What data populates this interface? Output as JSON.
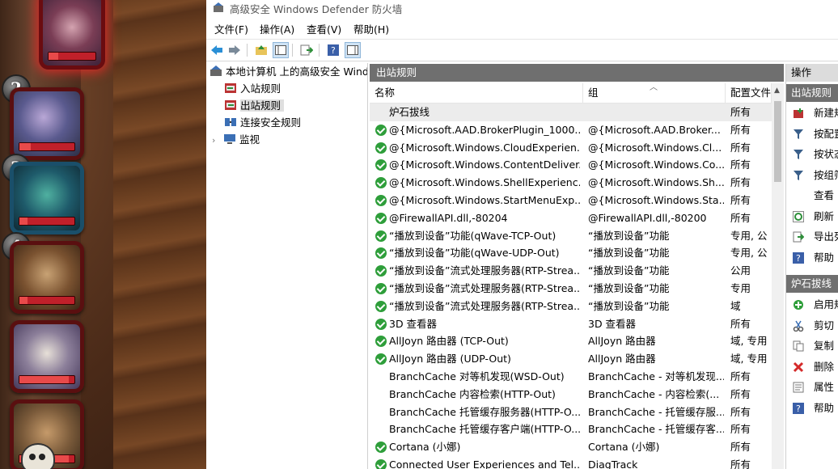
{
  "window": {
    "title": "高级安全 Windows Defender 防火墙"
  },
  "menu": [
    {
      "label": "文件(F)"
    },
    {
      "label": "操作(A)"
    },
    {
      "label": "查看(V)"
    },
    {
      "label": "帮助(H)"
    }
  ],
  "toolbar": [
    {
      "icon": "back-arrow-icon"
    },
    {
      "icon": "forward-arrow-icon"
    },
    {
      "icon": "up-folder-icon"
    },
    {
      "icon": "show-hide-tree-icon"
    },
    {
      "icon": "export-list-icon"
    },
    {
      "icon": "help-icon"
    },
    {
      "icon": "show-hide-action-pane-icon"
    }
  ],
  "tree": {
    "root": "本地计算机 上的高级安全 Windows Defender 防火墙",
    "items": [
      {
        "label": "入站规则"
      },
      {
        "label": "出站规则",
        "selected": true
      },
      {
        "label": "连接安全规则"
      },
      {
        "label": "监视",
        "expandable": true
      }
    ]
  },
  "list": {
    "header": "出站规则",
    "columns": [
      "名称",
      "组",
      "配置文件"
    ],
    "rows": [
      {
        "type": "group",
        "name": "炉石拔线",
        "group": "",
        "profile": "所有"
      },
      {
        "enabled": true,
        "name": "@{Microsoft.AAD.BrokerPlugin_1000....",
        "group": "@{Microsoft.AAD.Broker...",
        "profile": "所有"
      },
      {
        "enabled": true,
        "name": "@{Microsoft.Windows.CloudExperien...",
        "group": "@{Microsoft.Windows.Cl...",
        "profile": "所有"
      },
      {
        "enabled": true,
        "name": "@{Microsoft.Windows.ContentDeliver...",
        "group": "@{Microsoft.Windows.Co...",
        "profile": "所有"
      },
      {
        "enabled": true,
        "name": "@{Microsoft.Windows.ShellExperienc...",
        "group": "@{Microsoft.Windows.Sh...",
        "profile": "所有"
      },
      {
        "enabled": true,
        "name": "@{Microsoft.Windows.StartMenuExp...",
        "group": "@{Microsoft.Windows.Sta...",
        "profile": "所有"
      },
      {
        "enabled": true,
        "name": "@FirewallAPI.dll,-80204",
        "group": "@FirewallAPI.dll,-80200",
        "profile": "所有"
      },
      {
        "enabled": true,
        "name": "“播放到设备”功能(qWave-TCP-Out)",
        "group": "“播放到设备”功能",
        "profile": "专用, 公"
      },
      {
        "enabled": true,
        "name": "“播放到设备”功能(qWave-UDP-Out)",
        "group": "“播放到设备”功能",
        "profile": "专用, 公"
      },
      {
        "enabled": true,
        "name": "“播放到设备”流式处理服务器(RTP-Strea...",
        "group": "“播放到设备”功能",
        "profile": "公用"
      },
      {
        "enabled": true,
        "name": "“播放到设备”流式处理服务器(RTP-Strea...",
        "group": "“播放到设备”功能",
        "profile": "专用"
      },
      {
        "enabled": true,
        "name": "“播放到设备”流式处理服务器(RTP-Strea...",
        "group": "“播放到设备”功能",
        "profile": "域"
      },
      {
        "enabled": true,
        "name": "3D 查看器",
        "group": "3D 查看器",
        "profile": "所有"
      },
      {
        "enabled": true,
        "name": "AllJoyn 路由器 (TCP-Out)",
        "group": "AllJoyn 路由器",
        "profile": "域, 专用"
      },
      {
        "enabled": true,
        "name": "AllJoyn 路由器 (UDP-Out)",
        "group": "AllJoyn 路由器",
        "profile": "域, 专用"
      },
      {
        "enabled": false,
        "name": "BranchCache 对等机发现(WSD-Out)",
        "group": "BranchCache - 对等机发现...",
        "profile": "所有"
      },
      {
        "enabled": false,
        "name": "BranchCache 内容检索(HTTP-Out)",
        "group": "BranchCache - 内容检索(...",
        "profile": "所有"
      },
      {
        "enabled": false,
        "name": "BranchCache 托管缓存服务器(HTTP-O...",
        "group": "BranchCache - 托管缓存服...",
        "profile": "所有"
      },
      {
        "enabled": false,
        "name": "BranchCache 托管缓存客户端(HTTP-O...",
        "group": "BranchCache - 托管缓存客...",
        "profile": "所有"
      },
      {
        "enabled": true,
        "name": "Cortana (小娜)",
        "group": "Cortana (小娜)",
        "profile": "所有"
      },
      {
        "enabled": true,
        "name": "Connected User Experiences and Tel...",
        "group": "DiagTrack",
        "profile": "所有"
      }
    ]
  },
  "actions": {
    "header": "操作",
    "section1": {
      "title": "出站规则",
      "items": [
        {
          "label": "新建规则...",
          "icon": "new-rule-icon"
        },
        {
          "label": "按配置文件筛选",
          "icon": "filter-icon"
        },
        {
          "label": "按状态筛选",
          "icon": "filter-icon"
        },
        {
          "label": "按组筛选",
          "icon": "filter-icon"
        },
        {
          "label": "查看",
          "icon": ""
        },
        {
          "label": "刷新",
          "icon": "refresh-icon"
        },
        {
          "label": "导出列表...",
          "icon": "export-icon"
        },
        {
          "label": "帮助",
          "icon": "help-icon"
        }
      ]
    },
    "section2": {
      "title": "炉石拔线",
      "items": [
        {
          "label": "启用规则",
          "icon": "enable-icon"
        },
        {
          "label": "剪切",
          "icon": "cut-icon"
        },
        {
          "label": "复制",
          "icon": "copy-icon"
        },
        {
          "label": "删除",
          "icon": "delete-icon"
        },
        {
          "label": "属性",
          "icon": "properties-icon"
        },
        {
          "label": "帮助",
          "icon": "help-icon"
        }
      ]
    }
  },
  "game": {
    "slot_numbers": [
      "2",
      "3",
      "4"
    ],
    "health_levels": [
      0.2,
      0.2,
      0.15,
      0.15,
      0.9,
      0.9
    ]
  }
}
